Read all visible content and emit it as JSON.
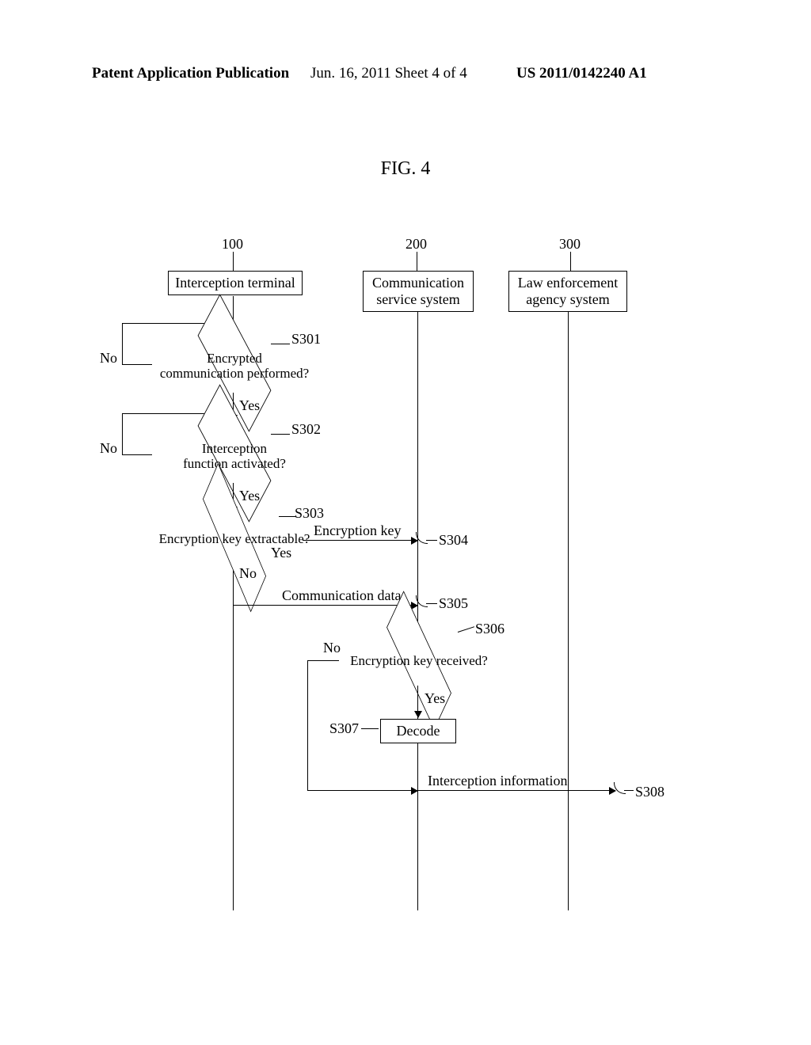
{
  "header": {
    "left": "Patent Application Publication",
    "mid": "Jun. 16, 2011  Sheet 4 of 4",
    "right": "US 2011/0142240 A1"
  },
  "figure_title": "FIG. 4",
  "lanes": {
    "a_num": "100",
    "b_num": "200",
    "c_num": "300",
    "a": "Interception terminal",
    "b": "Communication\nservice system",
    "c": "Law enforcement\nagency system"
  },
  "steps": {
    "s301": "S301",
    "s302": "S302",
    "s303": "S303",
    "s304": "S304",
    "s305": "S305",
    "s306": "S306",
    "s307": "S307",
    "s308": "S308"
  },
  "decisions": {
    "d1": "Encrypted\ncommunication performed?",
    "d2": "Interception\nfunction activated?",
    "d3": "Encryption key extractable?",
    "d4": "Encryption key received?"
  },
  "process": {
    "decode": "Decode"
  },
  "messages": {
    "m1": "Encryption key",
    "m2": "Communication data",
    "m3": "Interception information"
  },
  "branches": {
    "yes": "Yes",
    "no": "No"
  }
}
